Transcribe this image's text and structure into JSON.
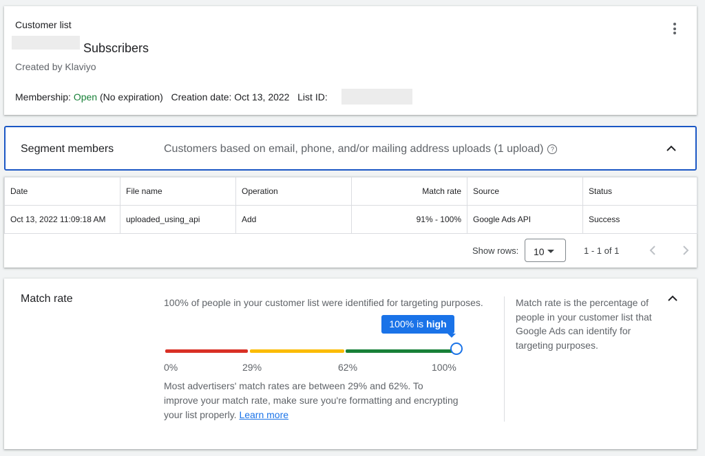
{
  "header": {
    "kicker": "Customer list",
    "title": "Subscribers",
    "created_by": "Created by Klaviyo",
    "membership_label": "Membership:",
    "membership_status": "Open",
    "membership_expiry": "(No expiration)",
    "creation_date_label": "Creation date:",
    "creation_date": "Oct 13, 2022",
    "list_id_label": "List ID:",
    "more_icon": "more-vert-icon"
  },
  "segment": {
    "title": "Segment members",
    "description": "Customers based on email, phone, and/or mailing address uploads (1 upload)",
    "help_glyph": "?",
    "columns": [
      "Date",
      "File name",
      "Operation",
      "Match rate",
      "Source",
      "Status"
    ],
    "rows": [
      {
        "date": "Oct 13, 2022 11:09:18 AM",
        "file_name": "uploaded_using_api",
        "operation": "Add",
        "match_rate": "91% - 100%",
        "source": "Google Ads API",
        "status": "Success"
      }
    ],
    "pager": {
      "show_rows_label": "Show rows:",
      "rows_value": "10",
      "range": "1 - 1 of 1"
    }
  },
  "match_rate": {
    "title": "Match rate",
    "intro": "100% of people in your customer list were identified for targeting purposes.",
    "tooltip_prefix": "100% is ",
    "tooltip_strong": "high",
    "value_percent": 100,
    "ticks": [
      "0%",
      "29%",
      "62%",
      "100%"
    ],
    "note": "Most advertisers' match rates are between 29% and 62%. To improve your match rate, make sure you're formatting and encrypting your list properly.",
    "learn_more": "Learn more",
    "side_text": "Match rate is the percentage of people in your customer list that Google Ads can identify for targeting purposes.",
    "colors": {
      "low": "#d93025",
      "medium": "#fbbc04",
      "high": "#188038",
      "accent": "#1a73e8"
    }
  }
}
